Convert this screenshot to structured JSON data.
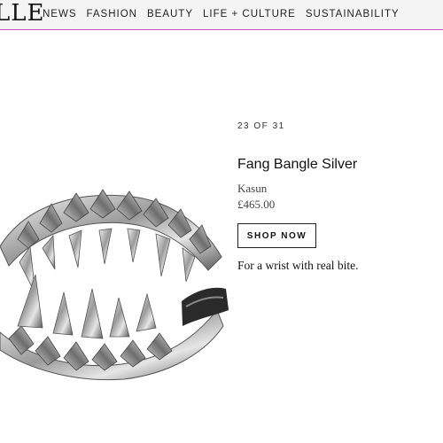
{
  "header": {
    "logo": "LLE",
    "nav": [
      "NEWS",
      "FASHION",
      "BEAUTY",
      "LIFE + CULTURE",
      "SUSTAINABILITY"
    ],
    "accent_color": "#c64fc0"
  },
  "gallery": {
    "counter": "23 OF 31"
  },
  "product": {
    "title": "Fang Bangle Silver",
    "brand": "Kasun",
    "price": "£465.00",
    "cta_label": "SHOP NOW",
    "tagline": "For a wrist with real bite.",
    "image": "silver-fang-bangle"
  }
}
